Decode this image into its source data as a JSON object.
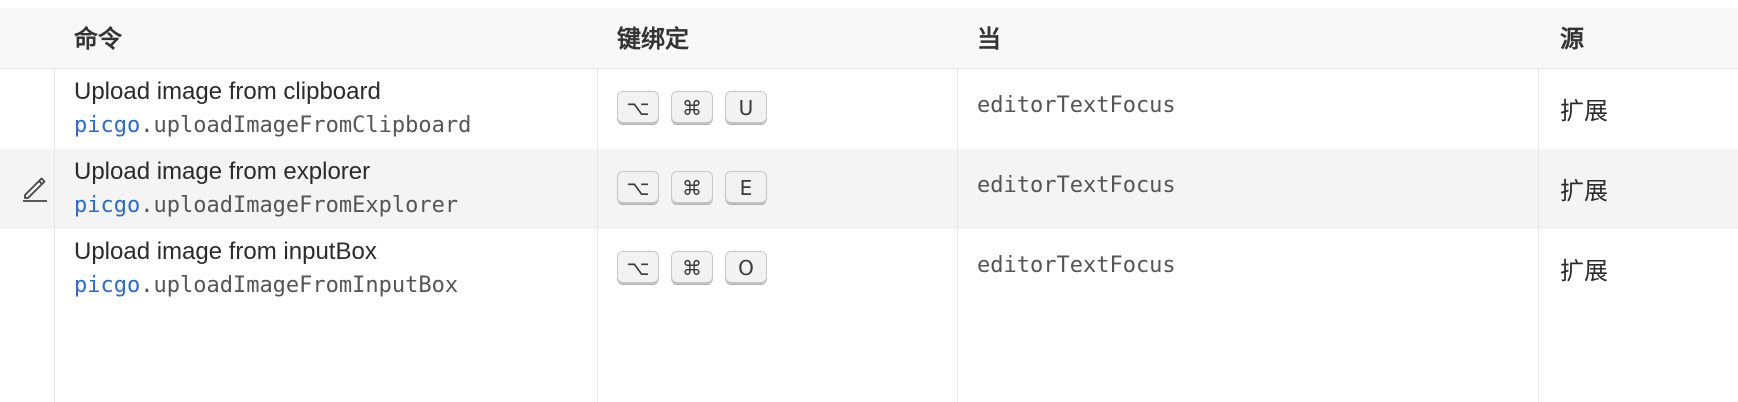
{
  "header": {
    "command": "命令",
    "keybinding": "键绑定",
    "when": "当",
    "source": "源"
  },
  "rows": [
    {
      "title": "Upload image from clipboard",
      "namespace": "picgo",
      "command_suffix": ".uploadImageFromClipboard",
      "keys": [
        "⌥",
        "⌘",
        "U"
      ],
      "when": "editorTextFocus",
      "source": "扩展",
      "edit_icon": ""
    },
    {
      "title": "Upload image from explorer",
      "namespace": "picgo",
      "command_suffix": ".uploadImageFromExplorer",
      "keys": [
        "⌥",
        "⌘",
        "E"
      ],
      "when": "editorTextFocus",
      "source": "扩展",
      "edit_icon": "pencil-icon"
    },
    {
      "title": "Upload image from inputBox",
      "namespace": "picgo",
      "command_suffix": ".uploadImageFromInputBox",
      "keys": [
        "⌥",
        "⌘",
        "O"
      ],
      "when": "editorTextFocus",
      "source": "扩展",
      "edit_icon": ""
    }
  ],
  "colors": {
    "namespace": "#2d6bc2",
    "row_hover": "#f4f4f4",
    "header_bg": "#f8f8f8"
  }
}
